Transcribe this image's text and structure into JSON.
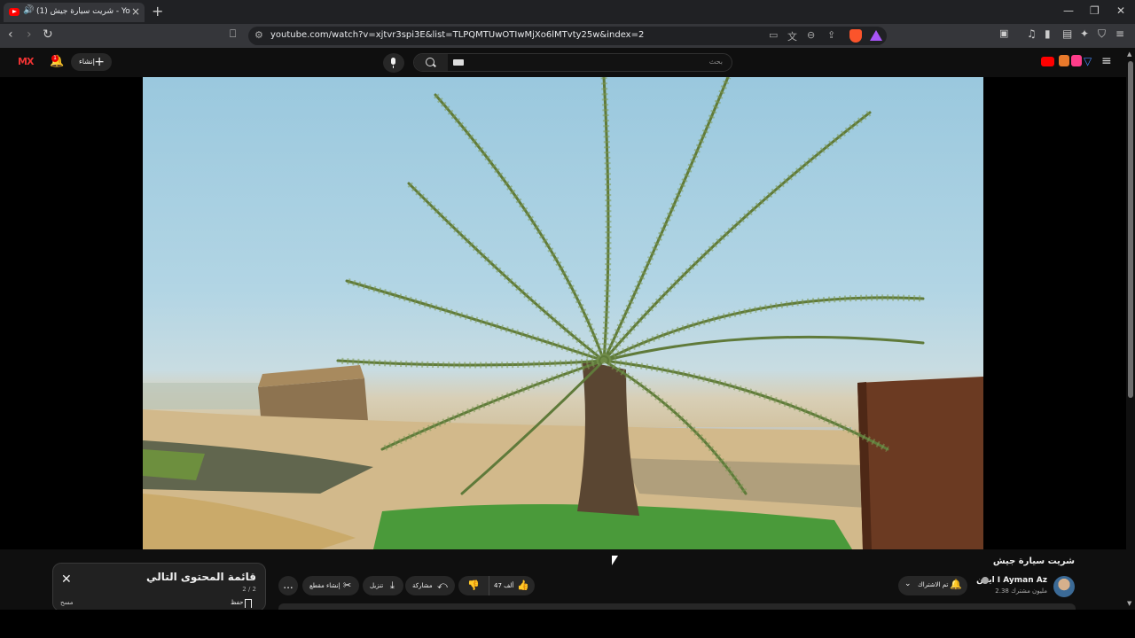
{
  "browser": {
    "tab_title": "(1) شريت سيارة جيش - YouTube",
    "url": "youtube.com/watch?v=xjtvr3spi3E&list=TLPQMTUwOTIwMjXo6lMTvty25w&index=2",
    "icons": {
      "minimize": "minimize-icon",
      "restore": "restore-icon",
      "close": "close-icon",
      "back": "back-arrow-icon",
      "forward": "forward-arrow-icon",
      "reload": "reload-icon",
      "bookmark": "bookmark-icon"
    },
    "colors": {
      "tab_bg": "#35363a",
      "strip_bg": "#202124",
      "brave": "#fb542b"
    }
  },
  "youtube_header": {
    "create_label": "إنشاء",
    "search_placeholder": "بحث",
    "notification_count": "1",
    "colors": {
      "brand_red": "#ff0000",
      "header_bg": "#0f0f0f"
    }
  },
  "video": {
    "title": "شريت سيارة جيش",
    "channel_name": "ايمن I Ayman Az",
    "subscribers": "2.38 مليون مشترك",
    "subscribe_label": "تم الاشتراك",
    "likes": "47 ألف",
    "share_label": "مشاركة",
    "download_label": "تنزيل",
    "clip_label": "إنشاء مقطع",
    "more_label": "..."
  },
  "playlist": {
    "title": "قائمة المحتوى التالي",
    "position": "2 / 2",
    "save_label": "حفظ",
    "more_label": "مسح"
  }
}
